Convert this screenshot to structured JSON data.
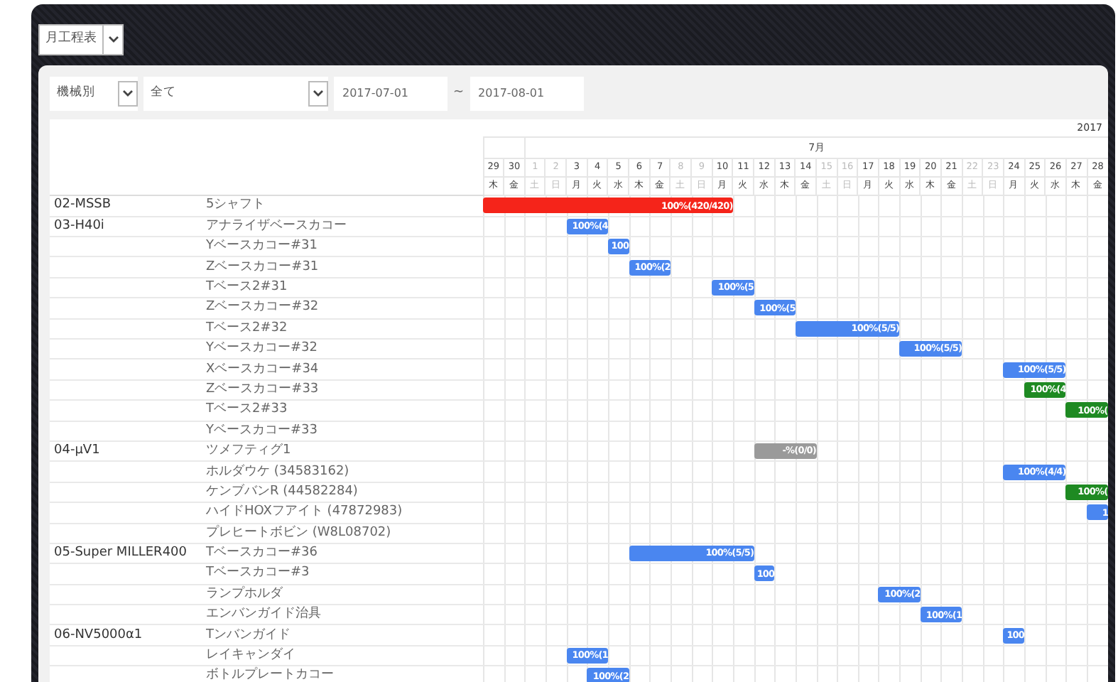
{
  "view_select": {
    "value": "月工程表"
  },
  "filters": {
    "group_select": "機械別",
    "machine_select": "全て",
    "date_from": "2017-07-01",
    "separator": "~",
    "date_to": "2017-08-01"
  },
  "header": {
    "year": "2017",
    "month": "7月"
  },
  "days": [
    {
      "label": "29",
      "weekday": "木",
      "weekend": false
    },
    {
      "label": "30",
      "weekday": "金",
      "weekend": false
    },
    {
      "label": "1",
      "weekday": "土",
      "weekend": true
    },
    {
      "label": "2",
      "weekday": "日",
      "weekend": true
    },
    {
      "label": "3",
      "weekday": "月",
      "weekend": false
    },
    {
      "label": "4",
      "weekday": "火",
      "weekend": false
    },
    {
      "label": "5",
      "weekday": "水",
      "weekend": false
    },
    {
      "label": "6",
      "weekday": "木",
      "weekend": false
    },
    {
      "label": "7",
      "weekday": "金",
      "weekend": false
    },
    {
      "label": "8",
      "weekday": "土",
      "weekend": true
    },
    {
      "label": "9",
      "weekday": "日",
      "weekend": true
    },
    {
      "label": "10",
      "weekday": "月",
      "weekend": false
    },
    {
      "label": "11",
      "weekday": "火",
      "weekend": false
    },
    {
      "label": "12",
      "weekday": "水",
      "weekend": false
    },
    {
      "label": "13",
      "weekday": "木",
      "weekend": false
    },
    {
      "label": "14",
      "weekday": "金",
      "weekend": false
    },
    {
      "label": "15",
      "weekday": "土",
      "weekend": true
    },
    {
      "label": "16",
      "weekday": "日",
      "weekend": true
    },
    {
      "label": "17",
      "weekday": "月",
      "weekend": false
    },
    {
      "label": "18",
      "weekday": "火",
      "weekend": false
    },
    {
      "label": "19",
      "weekday": "水",
      "weekend": false
    },
    {
      "label": "20",
      "weekday": "木",
      "weekend": false
    },
    {
      "label": "21",
      "weekday": "金",
      "weekend": false
    },
    {
      "label": "22",
      "weekday": "土",
      "weekend": true
    },
    {
      "label": "23",
      "weekday": "日",
      "weekend": true
    },
    {
      "label": "24",
      "weekday": "月",
      "weekend": false
    },
    {
      "label": "25",
      "weekday": "火",
      "weekend": false
    },
    {
      "label": "26",
      "weekday": "水",
      "weekend": false
    },
    {
      "label": "27",
      "weekday": "木",
      "weekend": false
    },
    {
      "label": "28",
      "weekday": "金",
      "weekend": false
    }
  ],
  "groups": [
    {
      "machine": "02-MSSB",
      "tasks": [
        {
          "name": "5シャフト",
          "bar": {
            "label": "100%(420/420)",
            "color": "#f5241a",
            "scheduled": [
              true,
              true,
              true,
              true,
              true,
              true,
              true,
              true,
              true,
              true,
              true,
              true,
              false,
              false,
              false,
              false,
              false,
              false,
              false,
              false,
              false,
              false,
              false,
              false,
              false,
              false,
              false,
              false,
              false,
              false
            ]
          }
        }
      ]
    },
    {
      "machine": "03-H40i",
      "tasks": [
        {
          "name": "アナライザベースカコー",
          "bar": {
            "label": "100%(4",
            "color": "#4a86f0",
            "scheduled": [
              false,
              false,
              false,
              false,
              true,
              true,
              false,
              false,
              false,
              false,
              false,
              false,
              false,
              false,
              false,
              false,
              false,
              false,
              false,
              false,
              false,
              false,
              false,
              false,
              false,
              false,
              false,
              false,
              false,
              false
            ]
          }
        },
        {
          "name": "Yベースカコー#31",
          "bar": {
            "label": "100",
            "color": "#4a86f0",
            "scheduled": [
              false,
              false,
              false,
              false,
              false,
              false,
              true,
              false,
              false,
              false,
              false,
              false,
              false,
              false,
              false,
              false,
              false,
              false,
              false,
              false,
              false,
              false,
              false,
              false,
              false,
              false,
              false,
              false,
              false,
              false
            ]
          }
        },
        {
          "name": "Zベースカコー#31",
          "bar": {
            "label": "100%(2",
            "color": "#4a86f0",
            "scheduled": [
              false,
              false,
              false,
              false,
              false,
              false,
              false,
              true,
              true,
              false,
              false,
              false,
              false,
              false,
              false,
              false,
              false,
              false,
              false,
              false,
              false,
              false,
              false,
              false,
              false,
              false,
              false,
              false,
              false,
              false
            ]
          }
        },
        {
          "name": "Tベース2#31",
          "bar": {
            "label": "100%(5",
            "color": "#4a86f0",
            "scheduled": [
              false,
              false,
              false,
              false,
              false,
              false,
              false,
              false,
              false,
              false,
              false,
              true,
              true,
              false,
              false,
              false,
              false,
              false,
              false,
              false,
              false,
              false,
              false,
              false,
              false,
              false,
              false,
              false,
              false,
              false
            ]
          }
        },
        {
          "name": "Zベースカコー#32",
          "bar": {
            "label": "100%(5",
            "color": "#4a86f0",
            "scheduled": [
              false,
              false,
              false,
              false,
              false,
              false,
              false,
              false,
              false,
              false,
              false,
              false,
              false,
              true,
              true,
              false,
              false,
              false,
              false,
              false,
              false,
              false,
              false,
              false,
              false,
              false,
              false,
              false,
              false,
              false
            ]
          }
        },
        {
          "name": "Tベース2#32",
          "bar": {
            "label": "100%(5/5)",
            "color": "#4a86f0",
            "scheduled": [
              false,
              false,
              false,
              false,
              false,
              false,
              false,
              false,
              false,
              false,
              false,
              false,
              false,
              false,
              false,
              true,
              true,
              true,
              true,
              true,
              false,
              false,
              false,
              false,
              false,
              false,
              false,
              false,
              false,
              false
            ]
          }
        },
        {
          "name": "Yベースカコー#32",
          "bar": {
            "label": "100%(5/5)",
            "color": "#4a86f0",
            "scheduled": [
              false,
              false,
              false,
              false,
              false,
              false,
              false,
              false,
              false,
              false,
              false,
              false,
              false,
              false,
              false,
              false,
              false,
              false,
              false,
              false,
              true,
              true,
              true,
              false,
              false,
              false,
              false,
              false,
              false,
              false
            ]
          }
        },
        {
          "name": "Xベースカコー#34",
          "bar": {
            "label": "100%(5/5)",
            "color": "#4a86f0",
            "scheduled": [
              false,
              false,
              false,
              false,
              false,
              false,
              false,
              false,
              false,
              false,
              false,
              false,
              false,
              false,
              false,
              false,
              false,
              false,
              false,
              false,
              false,
              false,
              false,
              false,
              false,
              true,
              true,
              true,
              false,
              false
            ]
          }
        },
        {
          "name": "Zベースカコー#33",
          "bar": {
            "label": "100%(4",
            "color": "#1e8a22",
            "scheduled": [
              false,
              false,
              false,
              false,
              false,
              false,
              false,
              false,
              false,
              false,
              false,
              false,
              false,
              false,
              false,
              false,
              false,
              false,
              false,
              false,
              false,
              false,
              false,
              false,
              false,
              false,
              true,
              true,
              false,
              false
            ]
          }
        },
        {
          "name": "Tベース2#33",
          "bar": {
            "label": "100%(",
            "color": "#1e8a22",
            "scheduled": [
              false,
              false,
              false,
              false,
              false,
              false,
              false,
              false,
              false,
              false,
              false,
              false,
              false,
              false,
              false,
              false,
              false,
              false,
              false,
              false,
              false,
              false,
              false,
              false,
              false,
              false,
              false,
              false,
              true,
              true
            ]
          }
        },
        {
          "name": "Yベースカコー#33"
        }
      ]
    },
    {
      "machine": "04-μV1",
      "tasks": [
        {
          "name": "ツメフティグ1",
          "bar": {
            "label": "-%(0/0)",
            "color": "#9a9a9a",
            "scheduled": [
              false,
              false,
              false,
              false,
              false,
              false,
              false,
              false,
              false,
              false,
              false,
              false,
              false,
              true,
              true,
              true,
              false,
              false,
              false,
              false,
              false,
              false,
              false,
              false,
              false,
              false,
              false,
              false,
              false,
              false
            ]
          }
        },
        {
          "name": "ホルダウケ (34583162)",
          "bar": {
            "label": "100%(4/4)",
            "color": "#4a86f0",
            "scheduled": [
              false,
              false,
              false,
              false,
              false,
              false,
              false,
              false,
              false,
              false,
              false,
              false,
              false,
              false,
              false,
              false,
              false,
              false,
              false,
              false,
              false,
              false,
              false,
              false,
              false,
              true,
              true,
              true,
              false,
              false
            ]
          }
        },
        {
          "name": "ケンブバンR (44582284)",
          "bar": {
            "label": "100%(",
            "color": "#1e8a22",
            "scheduled": [
              false,
              false,
              false,
              false,
              false,
              false,
              false,
              false,
              false,
              false,
              false,
              false,
              false,
              false,
              false,
              false,
              false,
              false,
              false,
              false,
              false,
              false,
              false,
              false,
              false,
              false,
              false,
              false,
              true,
              true
            ]
          }
        },
        {
          "name": "ハイドHOXフアイト (47872983)",
          "bar": {
            "label": "1",
            "color": "#4a86f0",
            "scheduled": [
              false,
              false,
              false,
              false,
              false,
              false,
              false,
              false,
              false,
              false,
              false,
              false,
              false,
              false,
              false,
              false,
              false,
              false,
              false,
              false,
              false,
              false,
              false,
              false,
              false,
              false,
              false,
              false,
              false,
              true
            ]
          }
        },
        {
          "name": "プレヒートボビン (W8L08702)"
        }
      ]
    },
    {
      "machine": "05-Super MILLER400",
      "tasks": [
        {
          "name": "Tベースカコー#36",
          "bar": {
            "label": "100%(5/5)",
            "color": "#4a86f0",
            "scheduled": [
              false,
              false,
              false,
              false,
              false,
              false,
              false,
              true,
              true,
              true,
              true,
              true,
              true,
              false,
              false,
              false,
              false,
              false,
              false,
              false,
              false,
              false,
              false,
              false,
              false,
              false,
              false,
              false,
              false,
              false
            ]
          }
        },
        {
          "name": "Tベースカコー#3",
          "bar": {
            "label": "100",
            "color": "#4a86f0",
            "scheduled": [
              false,
              false,
              false,
              false,
              false,
              false,
              false,
              false,
              false,
              false,
              false,
              false,
              false,
              true,
              false,
              false,
              false,
              false,
              false,
              false,
              false,
              false,
              false,
              false,
              false,
              false,
              false,
              false,
              false,
              false
            ]
          }
        },
        {
          "name": "ランプホルダ",
          "bar": {
            "label": "100%(2",
            "color": "#4a86f0",
            "scheduled": [
              false,
              false,
              false,
              false,
              false,
              false,
              false,
              false,
              false,
              false,
              false,
              false,
              false,
              false,
              false,
              false,
              false,
              false,
              false,
              true,
              true,
              false,
              false,
              false,
              false,
              false,
              false,
              false,
              false,
              false
            ]
          }
        },
        {
          "name": "エンバンガイド治具",
          "bar": {
            "label": "100%(1",
            "color": "#4a86f0",
            "scheduled": [
              false,
              false,
              false,
              false,
              false,
              false,
              false,
              false,
              false,
              false,
              false,
              false,
              false,
              false,
              false,
              false,
              false,
              false,
              false,
              false,
              false,
              true,
              true,
              false,
              false,
              false,
              false,
              false,
              false,
              false
            ]
          }
        }
      ]
    },
    {
      "machine": "06-NV5000α1",
      "tasks": [
        {
          "name": "Tンバンガイド",
          "bar": {
            "label": "100",
            "color": "#4a86f0",
            "scheduled": [
              false,
              false,
              false,
              false,
              false,
              false,
              false,
              false,
              false,
              false,
              false,
              false,
              false,
              false,
              false,
              false,
              false,
              false,
              false,
              false,
              false,
              false,
              false,
              false,
              false,
              true,
              false,
              false,
              false,
              false
            ]
          }
        },
        {
          "name": "レイキャンダイ",
          "bar": {
            "label": "100%(1",
            "color": "#4a86f0",
            "scheduled": [
              false,
              false,
              false,
              false,
              true,
              true,
              false,
              false,
              false,
              false,
              false,
              false,
              false,
              false,
              false,
              false,
              false,
              false,
              false,
              false,
              false,
              false,
              false,
              false,
              false,
              false,
              false,
              false,
              false,
              false
            ]
          }
        },
        {
          "name": "ボトルプレートカコー",
          "bar": {
            "label": "100%(2",
            "color": "#4a86f0",
            "scheduled": [
              false,
              false,
              false,
              false,
              false,
              true,
              true,
              false,
              false,
              false,
              false,
              false,
              false,
              false,
              false,
              false,
              false,
              false,
              false,
              false,
              false,
              false,
              false,
              false,
              false,
              false,
              false,
              false,
              false,
              false
            ]
          }
        }
      ]
    }
  ]
}
